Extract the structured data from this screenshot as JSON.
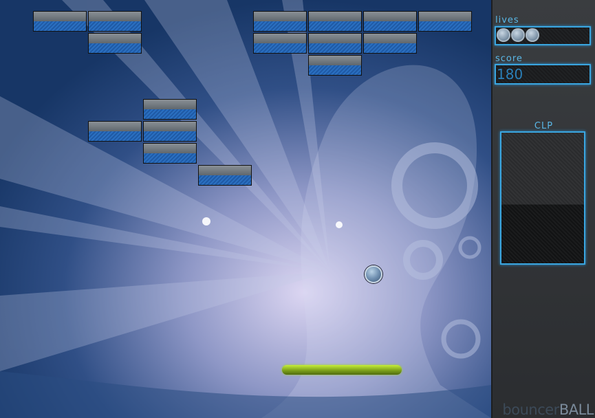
{
  "game": {
    "title_part1": "bouncer",
    "title_part2": "BALL",
    "lives_label": "lives",
    "lives_remaining": 3,
    "score_label": "score",
    "score_value": "180",
    "clp_label": "CLP"
  },
  "colors": {
    "accent": "#3aa6e0",
    "brick_top": "#7a8087",
    "brick_bottom": "#2268b8",
    "paddle": "#9cc92a",
    "background": "#1e3a6e"
  },
  "icons": [
    "ball",
    "paddle",
    "life-ball-icon"
  ]
}
